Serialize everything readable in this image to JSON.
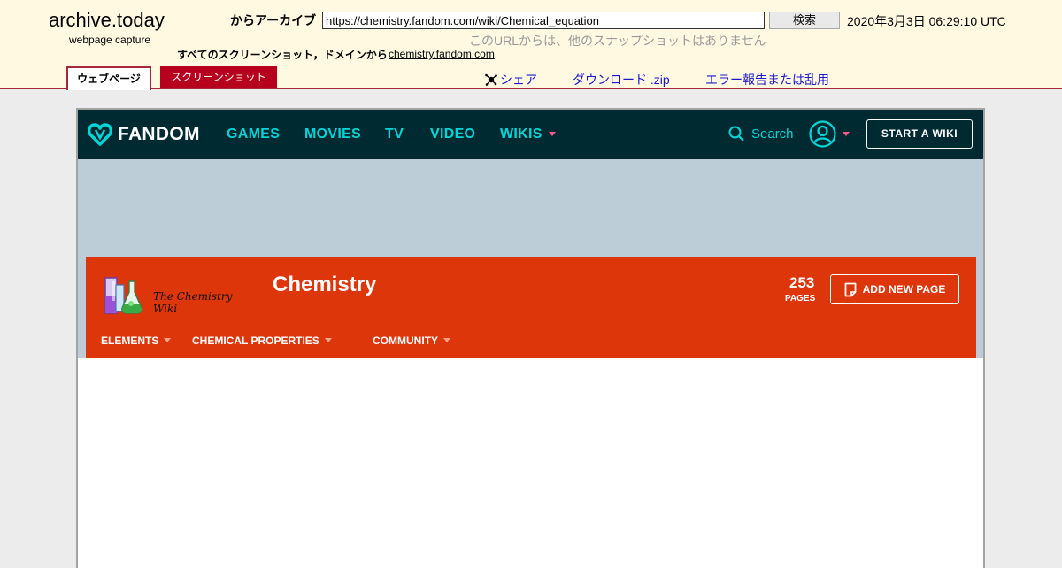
{
  "archive": {
    "logo": "archive.today",
    "logo_sub": "webpage capture",
    "from_label": "からアーカイブ",
    "url_value": "https://chemistry.fandom.com/wiki/Chemical_equation",
    "search_label": "検索",
    "date": "2020年3月3日 06:29:10 UTC",
    "no_snapshot": "このURLからは、他のスナップショットはありません",
    "all_shots_label": "すべてのスクリーンショット，ドメインから",
    "domain_link": "chemistry.fandom.com",
    "tabs": {
      "webpage": "ウェブページ",
      "screenshot": "スクリーンショット"
    },
    "actions": {
      "share": "シェア",
      "download": "ダウンロード .zip",
      "report": "エラー報告または乱用"
    },
    "colors": {
      "band": "#fff9e2",
      "accent": "#a7283c",
      "link": "#1a1acc"
    }
  },
  "fandom": {
    "brand": "FANDOM",
    "nav": [
      "GAMES",
      "MOVIES",
      "TV",
      "VIDEO",
      "WIKIS"
    ],
    "search": "Search",
    "start_wiki": "START A WIKI",
    "colors": {
      "nav_bg": "#002a32",
      "nav_link": "#00d6d6",
      "header": "#dd360b"
    }
  },
  "wiki": {
    "logo_text": "The Chemistry Wiki",
    "title": "Chemistry",
    "pages_count": "253",
    "pages_label": "PAGES",
    "add_page": "ADD NEW PAGE",
    "local_nav": [
      "ELEMENTS",
      "CHEMICAL PROPERTIES",
      "COMMUNITY"
    ]
  }
}
